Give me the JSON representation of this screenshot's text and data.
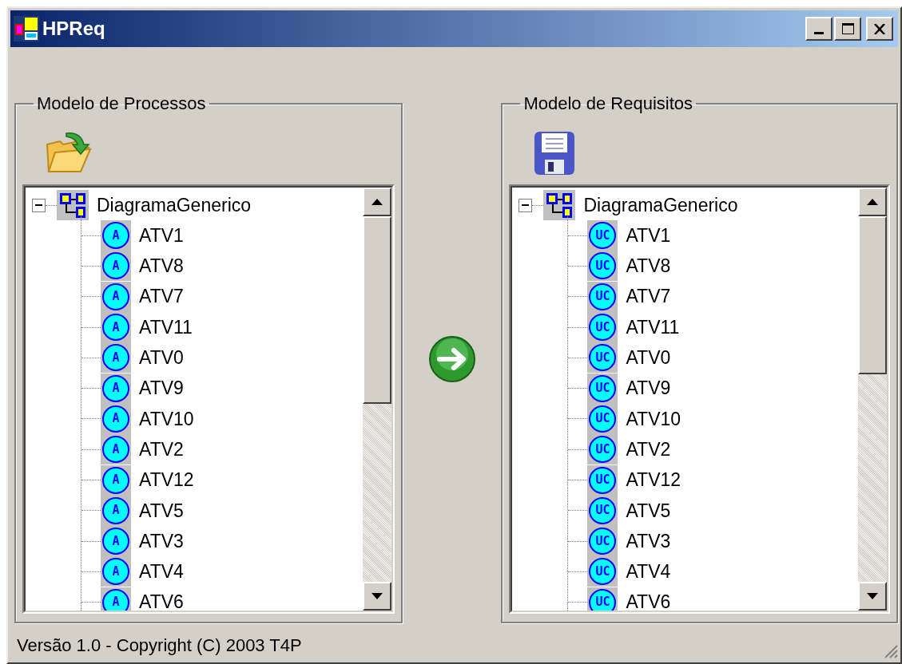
{
  "window": {
    "title": "HPReq"
  },
  "panels": [
    {
      "title": "Modelo de Processos",
      "kind": "open",
      "tree": {
        "label": "DiagramaGenerico",
        "expanded": true,
        "children": [
          {
            "label": "ATV1",
            "badge": "A"
          },
          {
            "label": "ATV8",
            "badge": "A"
          },
          {
            "label": "ATV7",
            "badge": "A"
          },
          {
            "label": "ATV11",
            "badge": "A"
          },
          {
            "label": "ATV0",
            "badge": "A"
          },
          {
            "label": "ATV9",
            "badge": "A"
          },
          {
            "label": "ATV10",
            "badge": "A"
          },
          {
            "label": "ATV2",
            "badge": "A"
          },
          {
            "label": "ATV12",
            "badge": "A"
          },
          {
            "label": "ATV5",
            "badge": "A"
          },
          {
            "label": "ATV3",
            "badge": "A"
          },
          {
            "label": "ATV4",
            "badge": "A"
          },
          {
            "label": "ATV6",
            "badge": "A"
          }
        ]
      }
    },
    {
      "title": "Modelo de Requisitos",
      "kind": "save",
      "tree": {
        "label": "DiagramaGenerico",
        "expanded": true,
        "children": [
          {
            "label": "ATV1",
            "badge": "UC"
          },
          {
            "label": "ATV8",
            "badge": "UC"
          },
          {
            "label": "ATV7",
            "badge": "UC"
          },
          {
            "label": "ATV11",
            "badge": "UC"
          },
          {
            "label": "ATV0",
            "badge": "UC"
          },
          {
            "label": "ATV9",
            "badge": "UC"
          },
          {
            "label": "ATV10",
            "badge": "UC"
          },
          {
            "label": "ATV2",
            "badge": "UC"
          },
          {
            "label": "ATV12",
            "badge": "UC"
          },
          {
            "label": "ATV5",
            "badge": "UC"
          },
          {
            "label": "ATV3",
            "badge": "UC"
          },
          {
            "label": "ATV4",
            "badge": "UC"
          },
          {
            "label": "ATV6",
            "badge": "UC"
          }
        ]
      }
    }
  ],
  "status_bar": "Versão 1.0 - Copyright (C) 2003 T4P"
}
